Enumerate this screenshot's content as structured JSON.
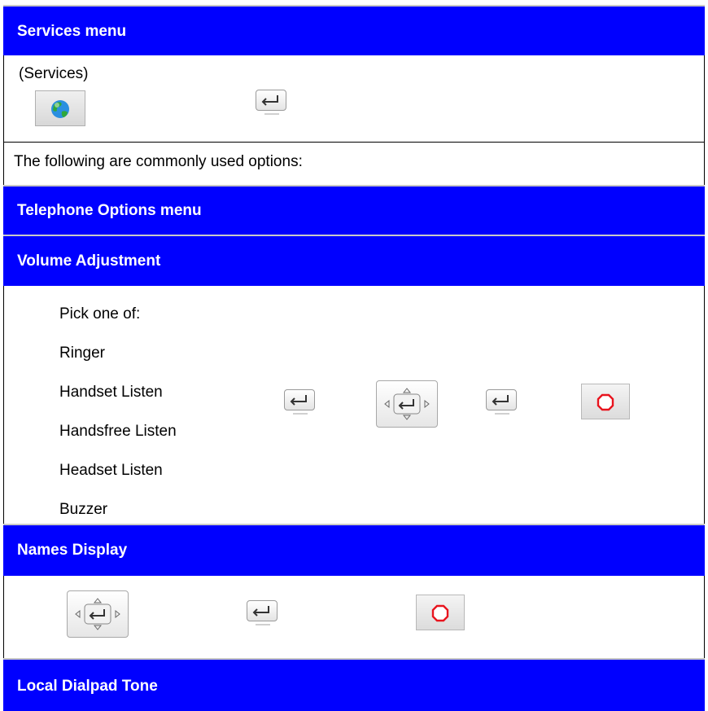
{
  "sections": {
    "services_menu": "Services menu",
    "services_label": "(Services)",
    "intro": "The following are commonly used options:",
    "telephone_options_menu": "Telephone Options menu",
    "volume_adjustment": "Volume Adjustment",
    "names_display": "Names Display",
    "local_dialpad_tone": "Local Dialpad Tone"
  },
  "volume_options": {
    "prompt": "Pick one of:",
    "items": [
      "Ringer",
      "Handset Listen",
      "Handsfree Listen",
      "Headset Listen",
      "Buzzer"
    ]
  },
  "icons": {
    "services": "globe-icon",
    "enter": "enter-arrow-icon",
    "navigation": "navigation-cluster-icon",
    "stop": "stop-octagon-icon"
  },
  "colors": {
    "header_background": "#0000ff",
    "header_text": "#ffffff",
    "stop_icon": "#e8141e"
  }
}
